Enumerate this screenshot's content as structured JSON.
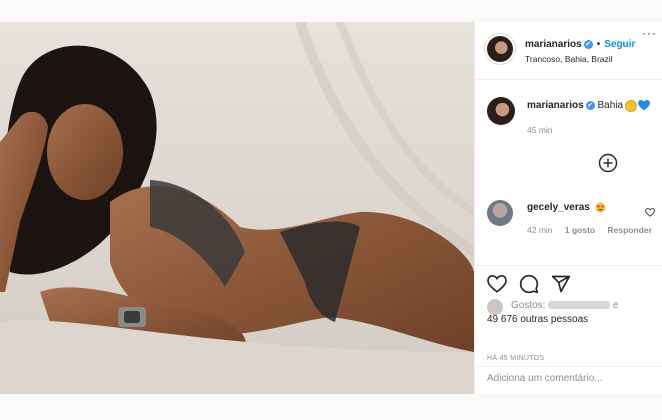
{
  "post": {
    "image_alt": "Woman lying on beach sand in a bikini",
    "author": {
      "username": "marianarios",
      "verified_glyph": "✔",
      "follow_label": "Seguir",
      "separator": "•",
      "location": "Trancoso, Bahia, Brazil",
      "more_glyph": "···"
    },
    "caption": {
      "username": "marianarios",
      "text": "Bahia",
      "time": "45 min"
    },
    "comment": {
      "username": "gecely_veras",
      "time": "42 min",
      "likes": "1 gosto",
      "reply_label": "Responder"
    },
    "likes": {
      "label": "Gostos:",
      "connector": "e",
      "others": "49 676 outras pessoas"
    },
    "posted_ago": "HÁ 45 MINUTOS",
    "add_comment_placeholder": "Adiciona um comentário..."
  },
  "icons": {
    "like": "heart-icon",
    "comment": "comment-icon",
    "share": "share-icon",
    "load_more": "plus-circle-icon"
  },
  "colors": {
    "accent": "#0095f6",
    "verified": "#3897f0",
    "muted": "#8e8e8e",
    "like_red": "#ed4956"
  }
}
